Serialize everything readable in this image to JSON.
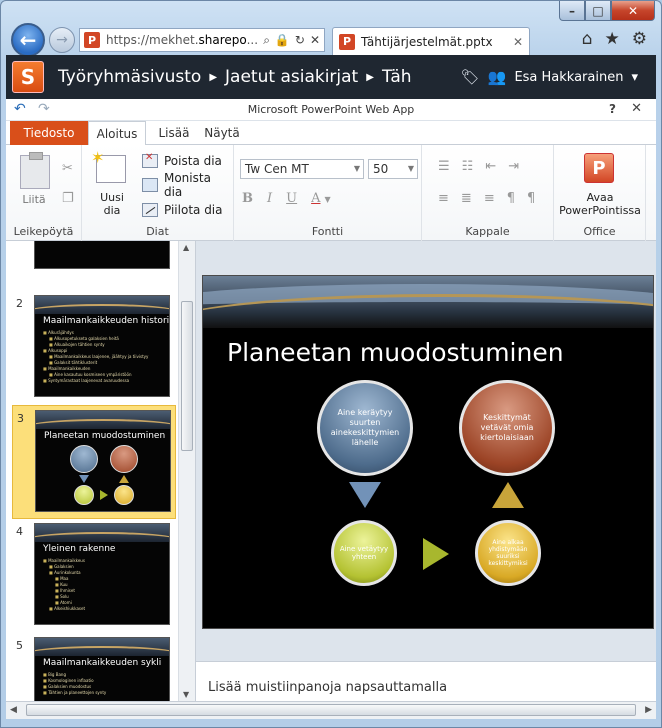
{
  "browser": {
    "url_prefix": "https://mekhet.",
    "url_domain": "sharepo",
    "url_rest": "...",
    "tab_title": "Tähtijärjestelmät.pptx",
    "tab_close": "✕",
    "back_icon": "back-arrow-icon",
    "forward_icon": "forward-arrow-icon"
  },
  "sharepoint": {
    "logo_letter": "S",
    "breadcrumb": [
      "Työryhmäsivusto",
      "Jaetut asiakirjat",
      "Täh"
    ],
    "user_name": "Esa Hakkarainen",
    "user_dropdown": "▾"
  },
  "app": {
    "title": "Microsoft PowerPoint Web App",
    "help": "?",
    "close": "✕"
  },
  "ribbon_tabs": {
    "file": "Tiedosto",
    "home": "Aloitus",
    "insert": "Lisää",
    "view": "Näytä"
  },
  "ribbon": {
    "clipboard": {
      "label": "Leikepöytä",
      "paste": "Liitä"
    },
    "slides": {
      "label": "Diat",
      "new_slide": "Uusi\ndia",
      "delete": "Poista dia",
      "duplicate": "Monista dia",
      "hide": "Piilota dia"
    },
    "font": {
      "label": "Fontti",
      "font_name": "Tw Cen MT",
      "font_size": "50",
      "bold": "B",
      "italic": "I",
      "underline": "U",
      "color": "A"
    },
    "paragraph": {
      "label": "Kappale"
    },
    "office": {
      "label": "Office",
      "open": "Avaa\nPowerPointissa",
      "icon_letter": "P"
    }
  },
  "thumbnails": [
    {
      "number": "2",
      "title": "Maailmankaikkeuden historia",
      "lines": [
        "Alkuräjähdys",
        "Alkusopetukseta galaksien heitä",
        "Alkuaikojen tähtien synty",
        "Alkusoppi",
        "Maailmankaikkeus laajenee, jäähtyy ja tiivistyy",
        "Galaksit tähtiklusterit",
        "Maailmankaikkeuden",
        "Aine kasautuu kosmiseen ympäristöön",
        "Syntymärastaat laajenevat avaruudessa"
      ]
    },
    {
      "number": "3",
      "title": "Planeetan muodostuminen",
      "selected": true
    },
    {
      "number": "4",
      "title": "Yleinen rakenne",
      "lines": [
        "Maailmankaikkeus",
        "Galaksien",
        "Aurinkokunta",
        "Maa",
        "Kuu",
        "Ihmiset",
        "Solu",
        "Atomi",
        "Alkeishiukkaset"
      ]
    },
    {
      "number": "5",
      "title": "Maailmankaikkeuden sykli",
      "lines": [
        "Big Bang",
        "Kosmologinen inflaatio",
        "Galaksien muodostus",
        "Tähtien ja planeettojen synty"
      ]
    }
  ],
  "slide": {
    "title": "Planeetan muodostuminen",
    "circles": {
      "blue": "Aine keräytyy suurten ainekeskittymien lähelle",
      "red": "Keskittymät vetävät omia kiertolaisiaan",
      "green": "Aine vetäytyy yhteen",
      "gold": "Aine alkaa yhdistymään suuriksi keskittymiksi"
    }
  },
  "notes": {
    "placeholder": "Lisää muistiinpanoja napsauttamalla"
  },
  "colors": {
    "file_tab": "#d94f1a",
    "selected_thumb": "#fcdf7a",
    "sp_header": "#1f2731"
  }
}
